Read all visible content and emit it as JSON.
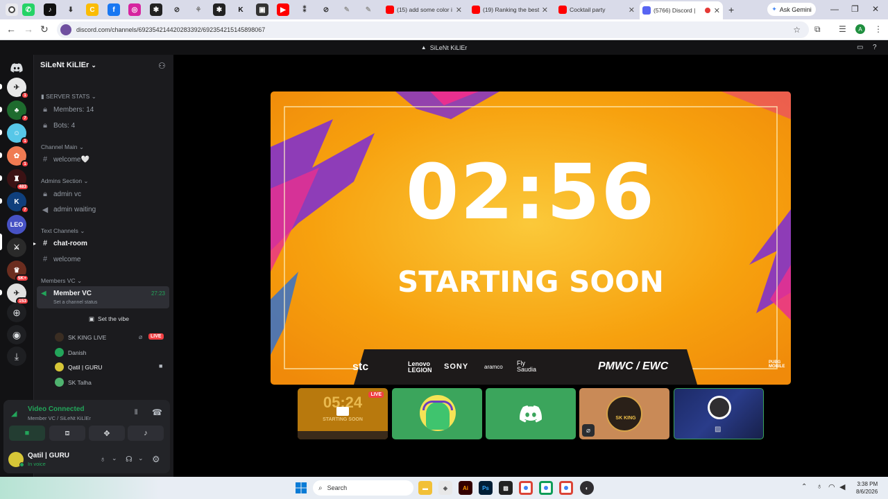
{
  "browser": {
    "tabs": [
      {
        "title": "(15) add some color i"
      },
      {
        "title": "(19) Ranking the best"
      },
      {
        "title": "Cocktail party"
      },
      {
        "title": "(5766) Discord | "
      }
    ],
    "ask_gemini": "Ask Gemini",
    "url": "discord.com/channels/692354214420283392/692354215145898067",
    "profile_initial": "A"
  },
  "discord": {
    "window_title": "SiLeNt KiLlEr",
    "server_name": "SiLeNt KiLlEr",
    "rail_badges": [
      "1",
      "7",
      "1",
      "1",
      "483",
      "7",
      "5K+",
      "153"
    ],
    "rail_leo": "LEO",
    "categories": {
      "server_stats": "SERVER STATS",
      "channel_main": "Channel Main",
      "admins_section": "Admins Section",
      "text_channels": "Text Channels",
      "members_vc": "Members VC"
    },
    "channels": {
      "members": "Members: 14",
      "bots": "Bots: 4",
      "welcome_heart": "welcome🤍",
      "admin_vc": "admin vc",
      "admin_waiting": "admin waiting",
      "chat_room": "chat-room",
      "welcome": "welcome",
      "member_vc": "Member VC",
      "member_vc_time": "27:23",
      "set_status": "Set a channel status"
    },
    "set_the_vibe": "Set the vibe",
    "voice_users": [
      {
        "name": "SK KING LIVE",
        "badge": "LIVE"
      },
      {
        "name": "Danish"
      },
      {
        "name": "Qatil | GURU"
      },
      {
        "name": "SK Talha"
      }
    ],
    "voice_panel": {
      "status": "Video Connected",
      "location": "Member VC / SiLeNt KiLlEr"
    },
    "user_panel": {
      "name": "Qatil | GURU",
      "status": "In voice"
    }
  },
  "stream": {
    "timer": "02:56",
    "headline": "STARTING SOON",
    "sponsors": [
      "stc",
      "Lenovo LEGION",
      "SONY",
      "aramco",
      "Fly Saudia"
    ],
    "event_logo": "PMWC / EWC",
    "corner_logo": "PUBG MOBILE"
  },
  "tiles": {
    "live_badge": "LIVE",
    "preview_timer": "05:24",
    "preview_text": "STARTING SOON",
    "sk_king_label": "SK KING"
  },
  "taskbar": {
    "search_placeholder": "Search",
    "time": "3:38 PM",
    "date": "8/6/2026"
  },
  "colors": {
    "discord_bg": "#1b1b1e",
    "rail_bg": "#121214",
    "discord_green": "#23a55a",
    "live_red": "#f23f43",
    "stream_orange": "#f7a10e"
  }
}
